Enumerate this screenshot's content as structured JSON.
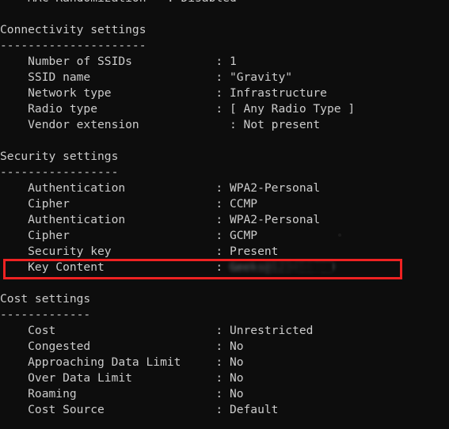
{
  "terminal": {
    "background_color": "#0d0d0d",
    "text_color": "#cccccc",
    "highlight_color": "#ee2222",
    "partial_top_line": {
      "label": "    MAC Randomization   ",
      "separator": ": ",
      "value": "Disabled"
    }
  },
  "sections": [
    {
      "title": "Connectivity settings",
      "rule": "---------------------",
      "rows": [
        {
          "label": "    Number of SSIDs            ",
          "separator": ": ",
          "value": "1"
        },
        {
          "label": "    SSID name                  ",
          "separator": ": ",
          "value": "\"Gravity\""
        },
        {
          "label": "    Network type               ",
          "separator": ": ",
          "value": "Infrastructure"
        },
        {
          "label": "    Radio type                 ",
          "separator": ": ",
          "value": "[ Any Radio Type ]"
        },
        {
          "label": "    Vendor extension             ",
          "separator": ": ",
          "value": "Not present"
        }
      ]
    },
    {
      "title": "Security settings",
      "rule": "-----------------",
      "rows": [
        {
          "label": "    Authentication             ",
          "separator": ": ",
          "value": "WPA2-Personal"
        },
        {
          "label": "    Cipher                     ",
          "separator": ": ",
          "value": "CCMP"
        },
        {
          "label": "    Authentication             ",
          "separator": ": ",
          "value": "WPA2-Personal"
        },
        {
          "label": "    Cipher                     ",
          "separator": ": ",
          "value": "GCMP"
        },
        {
          "label": "    Security key               ",
          "separator": ": ",
          "value": "Present"
        },
        {
          "label": "    Key Content                ",
          "separator": ": ",
          "value": "Geeks@123456789",
          "redacted": true,
          "highlighted": true
        }
      ]
    },
    {
      "title": "Cost settings",
      "rule": "-------------",
      "rows": [
        {
          "label": "    Cost                       ",
          "separator": ": ",
          "value": "Unrestricted"
        },
        {
          "label": "    Congested                  ",
          "separator": ": ",
          "value": "No"
        },
        {
          "label": "    Approaching Data Limit     ",
          "separator": ": ",
          "value": "No"
        },
        {
          "label": "    Over Data Limit            ",
          "separator": ": ",
          "value": "No"
        },
        {
          "label": "    Roaming                    ",
          "separator": ": ",
          "value": "No"
        },
        {
          "label": "    Cost Source                ",
          "separator": ": ",
          "value": "Default"
        }
      ]
    }
  ]
}
